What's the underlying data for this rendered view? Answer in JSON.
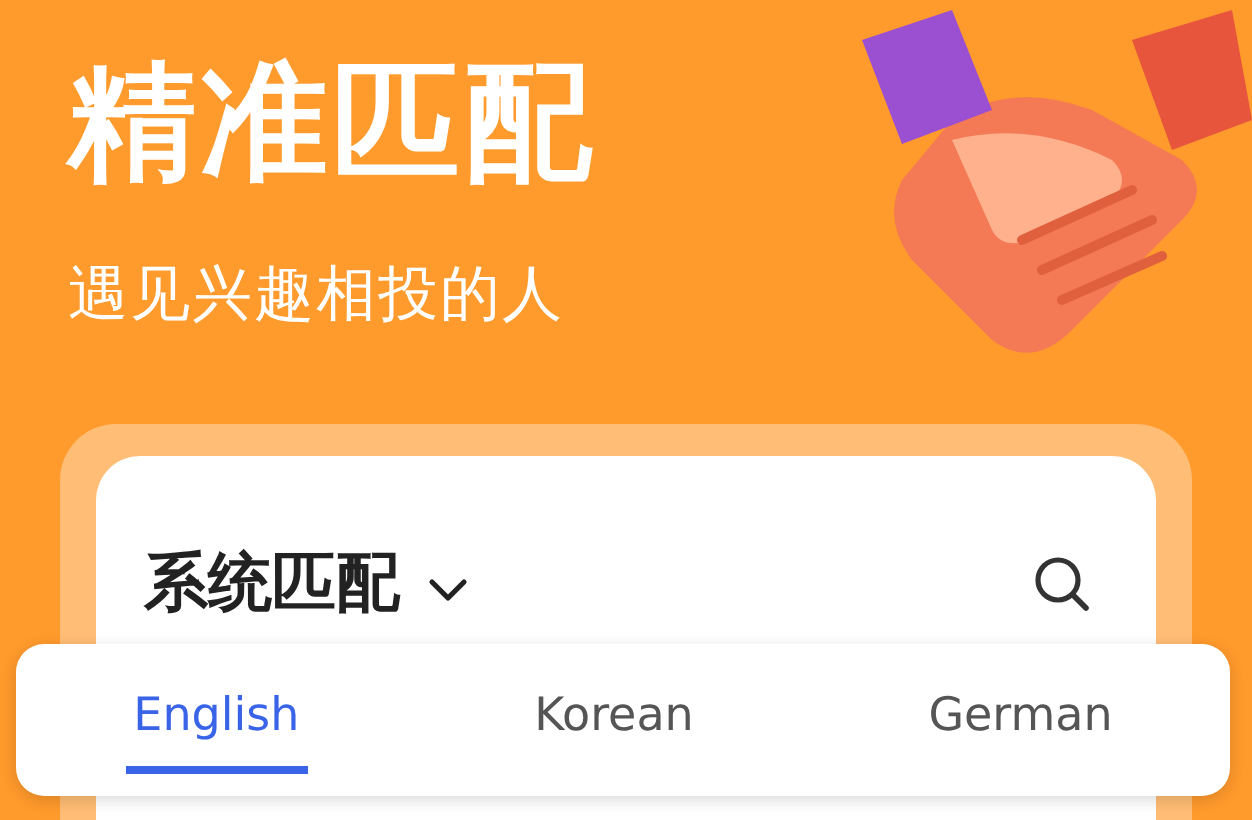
{
  "header": {
    "title": "精准匹配",
    "subtitle": "遇见兴趣相投的人"
  },
  "card": {
    "title": "系统匹配"
  },
  "tabs": [
    {
      "label": "English",
      "selected": true
    },
    {
      "label": "Korean",
      "selected": false
    },
    {
      "label": "German",
      "selected": false
    }
  ]
}
